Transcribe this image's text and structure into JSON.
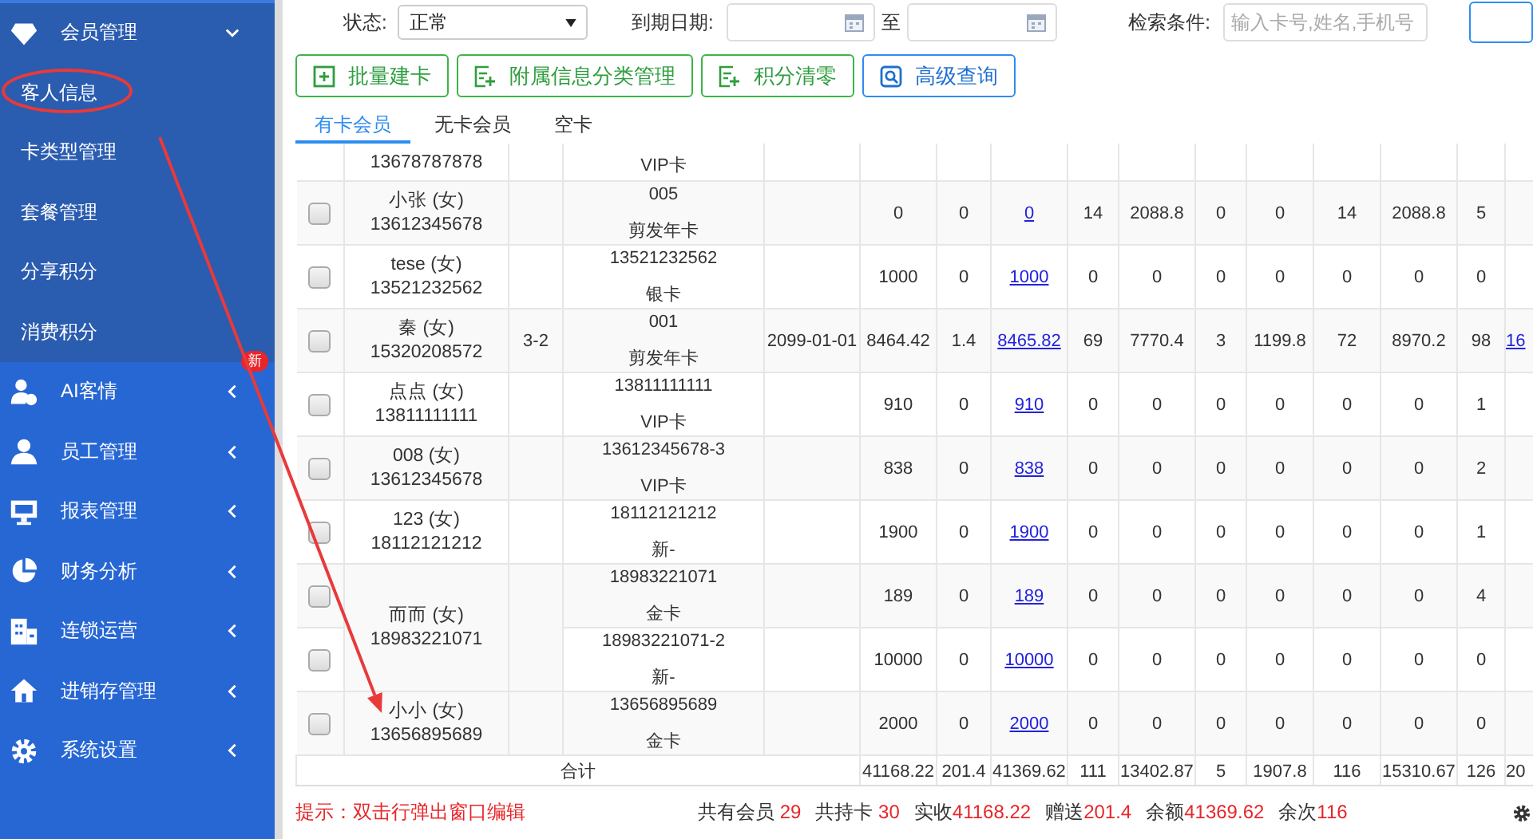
{
  "sidebar": {
    "groups": [
      {
        "label": "会员管理",
        "expanded": true,
        "children": [
          {
            "label": "客人信息"
          },
          {
            "label": "卡类型管理"
          },
          {
            "label": "套餐管理"
          },
          {
            "label": "分享积分"
          },
          {
            "label": "消费积分"
          }
        ]
      },
      {
        "label": "AI客情",
        "badge": "新",
        "expanded": false
      },
      {
        "label": "员工管理",
        "expanded": false
      },
      {
        "label": "报表管理",
        "expanded": false
      },
      {
        "label": "财务分析",
        "expanded": false
      },
      {
        "label": "连锁运营",
        "expanded": false
      },
      {
        "label": "进销存管理",
        "expanded": false
      },
      {
        "label": "系统设置",
        "expanded": false
      }
    ]
  },
  "filters": {
    "status": {
      "label": "状态:",
      "value": "正常"
    },
    "expiry": {
      "label": "到期日期:",
      "separator": "至"
    },
    "search": {
      "label": "检索条件:",
      "placeholder": "输入卡号,姓名,手机号"
    }
  },
  "actions": [
    {
      "label": "批量建卡",
      "kind": "add"
    },
    {
      "label": "附属信息分类管理",
      "kind": "edit"
    },
    {
      "label": "积分清零",
      "kind": "edit"
    },
    {
      "label": "高级查询",
      "kind": "query"
    }
  ],
  "tabs": [
    {
      "label": "有卡会员",
      "selected": true
    },
    {
      "label": "无卡会员",
      "selected": false
    },
    {
      "label": "空卡",
      "selected": false
    }
  ],
  "table": {
    "members": [
      {
        "phone": "13678787878",
        "cards": [
          {
            "card_type": "VIP卡"
          }
        ]
      },
      {
        "name": "小张 (女)",
        "phone": "13612345678",
        "cards": [
          {
            "checked": false,
            "card_no": "005",
            "card_type": "剪发年卡",
            "amounts": [
              "0",
              "0",
              "0",
              "14",
              "2088.8",
              "0",
              "0",
              "14",
              "2088.8",
              "5"
            ]
          }
        ]
      },
      {
        "name": "tese (女)",
        "phone": "13521232562",
        "cards": [
          {
            "checked": false,
            "card_no": "13521232562",
            "card_type": "银卡",
            "amounts": [
              "1000",
              "0",
              "1000",
              "0",
              "0",
              "0",
              "0",
              "0",
              "0",
              "0"
            ]
          }
        ]
      },
      {
        "name": "秦 (女)",
        "phone": "15320208572",
        "column_3": "3-2",
        "cards": [
          {
            "checked": false,
            "card_no": "001",
            "card_type": "剪发年卡",
            "expiry": "2099-01-01",
            "amounts": [
              "8464.42",
              "1.4",
              "8465.82",
              "69",
              "7770.4",
              "3",
              "1199.8",
              "72",
              "8970.2",
              "98"
            ],
            "column_16": "16"
          }
        ]
      },
      {
        "name": "点点 (女)",
        "phone": "13811111111",
        "cards": [
          {
            "checked": false,
            "card_no": "13811111111",
            "card_type": "VIP卡",
            "amounts": [
              "910",
              "0",
              "910",
              "0",
              "0",
              "0",
              "0",
              "0",
              "0",
              "1"
            ]
          }
        ]
      },
      {
        "name": "008 (女)",
        "phone": "13612345678",
        "cards": [
          {
            "checked": false,
            "card_no": "13612345678-3",
            "card_type": "VIP卡",
            "amounts": [
              "838",
              "0",
              "838",
              "0",
              "0",
              "0",
              "0",
              "0",
              "0",
              "2"
            ]
          }
        ]
      },
      {
        "name": "123 (女)",
        "phone": "18112121212",
        "cards": [
          {
            "checked": false,
            "card_no": "18112121212",
            "card_type": "新-",
            "amounts": [
              "1900",
              "0",
              "1900",
              "0",
              "0",
              "0",
              "0",
              "0",
              "0",
              "1"
            ]
          }
        ]
      },
      {
        "name": "而而 (女)",
        "phone": "18983221071",
        "cards": [
          {
            "checked": false,
            "card_no": "18983221071",
            "card_type": "金卡",
            "amounts": [
              "189",
              "0",
              "189",
              "0",
              "0",
              "0",
              "0",
              "0",
              "0",
              "4"
            ]
          },
          {
            "checked": false,
            "card_no": "18983221071-2",
            "card_type": "新-",
            "amounts": [
              "10000",
              "0",
              "10000",
              "0",
              "0",
              "0",
              "0",
              "0",
              "0",
              "0"
            ]
          }
        ]
      },
      {
        "name": "小小 (女)",
        "phone": "13656895689",
        "cards": [
          {
            "checked": false,
            "card_no": "13656895689",
            "card_type": "金卡",
            "amounts": [
              "2000",
              "0",
              "2000",
              "0",
              "0",
              "0",
              "0",
              "0",
              "0",
              "0"
            ]
          }
        ]
      }
    ],
    "totals": {
      "label": "合计",
      "values": [
        "41168.22",
        "201.4",
        "41369.62",
        "111",
        "13402.87",
        "5",
        "1907.8",
        "116",
        "15310.67",
        "126",
        "20"
      ]
    }
  },
  "footer": {
    "hint": "提示：双击行弹出窗口编辑",
    "stats": [
      {
        "label": "共有会员 ",
        "value": "29"
      },
      {
        "label": "共持卡 ",
        "value": "30"
      },
      {
        "label": "实收",
        "value": "41168.22"
      },
      {
        "label": "赠送",
        "value": "201.4"
      },
      {
        "label": "余额",
        "value": "41369.62"
      },
      {
        "label": "余次",
        "value": "116"
      }
    ]
  }
}
